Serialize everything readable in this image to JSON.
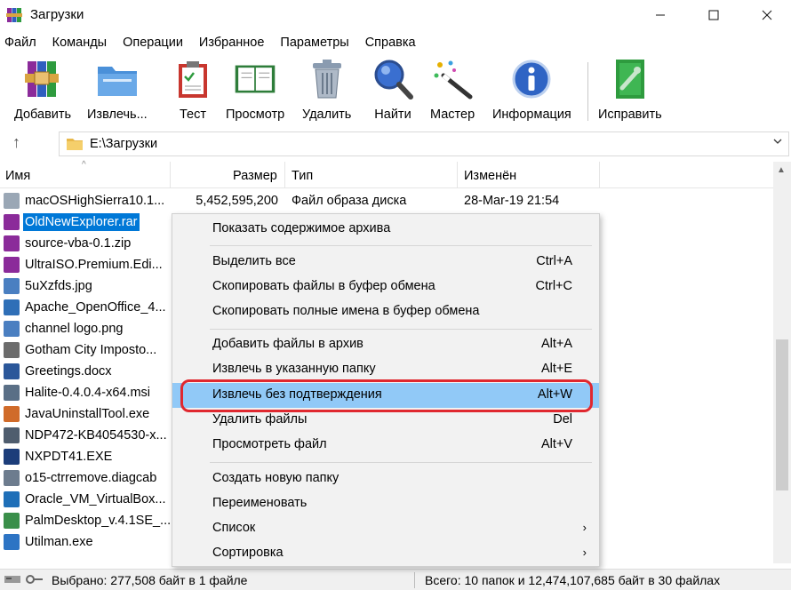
{
  "window": {
    "title": "Загрузки"
  },
  "menu": [
    "Файл",
    "Команды",
    "Операции",
    "Избранное",
    "Параметры",
    "Справка"
  ],
  "toolbar": [
    {
      "label": "Добавить",
      "icon": "add-archive-icon"
    },
    {
      "label": "Извлечь...",
      "icon": "extract-folder-icon"
    },
    {
      "label": "Тест",
      "icon": "test-clipboard-icon"
    },
    {
      "label": "Просмотр",
      "icon": "view-book-icon"
    },
    {
      "label": "Удалить",
      "icon": "trash-icon"
    },
    {
      "label": "Найти",
      "icon": "magnifier-icon"
    },
    {
      "label": "Мастер",
      "icon": "wizard-wand-icon"
    },
    {
      "label": "Информация",
      "icon": "info-icon"
    },
    {
      "label": "Исправить",
      "icon": "repair-icon"
    }
  ],
  "address": {
    "path": "E:\\Загрузки"
  },
  "columns": {
    "name": "Имя",
    "size": "Размер",
    "type": "Тип",
    "modified": "Изменён"
  },
  "files": [
    {
      "name": "macOSHighSierra10.1...",
      "size": "5,452,595,200",
      "type": "Файл образа диска",
      "modified": "28-Mar-19 21:54",
      "color": "#9aa7b5"
    },
    {
      "name": "OldNewExplorer.rar",
      "size": "",
      "type": "",
      "modified": "",
      "color": "#8b2b9a"
    },
    {
      "name": "source-vba-0.1.zip",
      "size": "",
      "type": "",
      "modified": "",
      "color": "#8b2b9a"
    },
    {
      "name": "UltraISO.Premium.Edi...",
      "size": "",
      "type": "",
      "modified": "",
      "color": "#8b2b9a"
    },
    {
      "name": "5uXzfds.jpg",
      "size": "",
      "type": "",
      "modified": "",
      "color": "#4a7fc1"
    },
    {
      "name": "Apache_OpenOffice_4...",
      "size": "",
      "type": "",
      "modified": "",
      "color": "#2f6fb7"
    },
    {
      "name": "channel logo.png",
      "size": "",
      "type": "",
      "modified": "",
      "color": "#4a7fc1"
    },
    {
      "name": "Gotham City Imposto...",
      "size": "",
      "type": "",
      "modified": "",
      "color": "#6c6c6c"
    },
    {
      "name": "Greetings.docx",
      "size": "",
      "type": "",
      "modified": "",
      "color": "#2b579a"
    },
    {
      "name": "Halite-0.4.0.4-x64.msi",
      "size": "",
      "type": "",
      "modified": "",
      "color": "#5a6f86"
    },
    {
      "name": "JavaUninstallTool.exe",
      "size": "",
      "type": "",
      "modified": "",
      "color": "#d06b2a"
    },
    {
      "name": "NDP472-KB4054530-x...",
      "size": "",
      "type": "",
      "modified": "",
      "color": "#4f5d6e"
    },
    {
      "name": "NXPDT41.EXE",
      "size": "",
      "type": "",
      "modified": "",
      "color": "#1c3d7a"
    },
    {
      "name": "o15-ctrremove.diagcab",
      "size": "",
      "type": "",
      "modified": "",
      "color": "#6d7c8e"
    },
    {
      "name": "Oracle_VM_VirtualBox...",
      "size": "",
      "type": "",
      "modified": "",
      "color": "#1e6fb8"
    },
    {
      "name": "PalmDesktop_v.4.1SE_...",
      "size": "",
      "type": "",
      "modified": "",
      "color": "#3a8f4a"
    },
    {
      "name": "Utilman.exe",
      "size": "",
      "type": "",
      "modified": "",
      "color": "#2d74c4"
    }
  ],
  "context_menu": [
    {
      "label": "Показать содержимое архива",
      "key": ""
    },
    {
      "label": "Выделить все",
      "key": "Ctrl+A"
    },
    {
      "label": "Скопировать файлы в буфер обмена",
      "key": "Ctrl+C"
    },
    {
      "label": "Скопировать полные имена в буфер обмена",
      "key": ""
    },
    {
      "label": "Добавить файлы в архив",
      "key": "Alt+A"
    },
    {
      "label": "Извлечь в указанную папку",
      "key": "Alt+E"
    },
    {
      "label": "Извлечь без подтверждения",
      "key": "Alt+W"
    },
    {
      "label": "Удалить файлы",
      "key": "Del"
    },
    {
      "label": "Просмотреть файл",
      "key": "Alt+V"
    },
    {
      "label": "Создать новую папку",
      "key": ""
    },
    {
      "label": "Переименовать",
      "key": ""
    },
    {
      "label": "Список",
      "key": "",
      "arrow": "›"
    },
    {
      "label": "Сортировка",
      "key": "",
      "arrow": "›"
    }
  ],
  "status": {
    "left": "Выбрано: 277,508 байт в 1 файле",
    "right": "Всего: 10 папок и 12,474,107,685 байт в 30 файлах"
  },
  "colors": {
    "selection": "#0078d7",
    "menu_highlight": "#91c9f7",
    "annotation_ring": "#e0282f"
  }
}
